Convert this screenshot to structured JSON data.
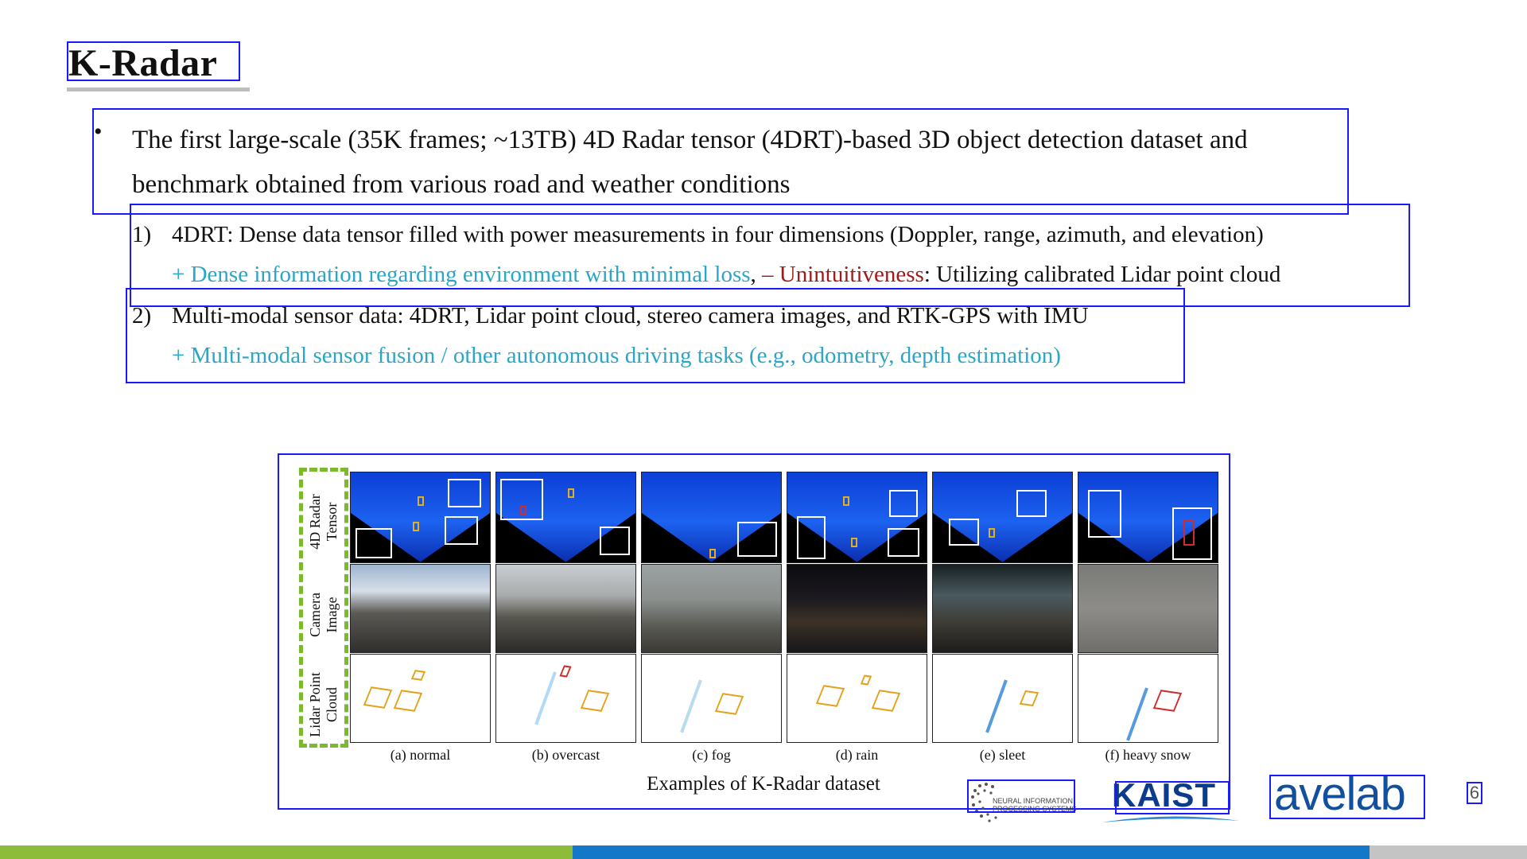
{
  "title": "K-Radar",
  "bullet": {
    "text_line1": "The first large-scale (35K frames; ~13TB) 4D Radar tensor (4DRT)-based 3D object detection dataset and",
    "text_line2": "benchmark obtained from various road and weather conditions"
  },
  "items": [
    {
      "num": "1)",
      "text": "4DRT: Dense data tensor filled with power measurements in four dimensions (Doppler, range, azimuth, and elevation)",
      "plus": "+ Dense information regarding environment with minimal loss",
      "sep": ", ",
      "minus": "– Unintuitiveness",
      "rest": ": Utilizing calibrated Lidar point cloud"
    },
    {
      "num": "2)",
      "text": "Multi-modal sensor data: 4DRT, Lidar point cloud, stereo camera images, and RTK-GPS with IMU",
      "plus": "+ Multi-modal sensor fusion / other autonomous driving tasks (e.g., odometry, depth estimation)"
    }
  ],
  "figure": {
    "row_labels": [
      {
        "line1": "4D Radar",
        "line2": "Tensor"
      },
      {
        "line1": "Camera",
        "line2": "Image"
      },
      {
        "line1": "Lidar Point",
        "line2": "Cloud"
      }
    ],
    "conditions": [
      "(a) normal",
      "(b) overcast",
      "(c) fog",
      "(d) rain",
      "(e) sleet",
      "(f) heavy snow"
    ],
    "caption": "Examples of K-Radar dataset"
  },
  "logos": {
    "neurips_line1": "NEURAL INFORMATION",
    "neurips_line2": "PROCESSING SYSTEMS",
    "kaist": "KAIST",
    "avelab": "avelab"
  },
  "page_number": "6",
  "colors": {
    "plus": "#2aa6c6",
    "minus": "#a0191b",
    "box": "#1a1aff",
    "dash": "#7aba2c",
    "footer_green": "#8dbb3a",
    "footer_blue": "#1577c7",
    "footer_gray": "#c4c4c4"
  }
}
